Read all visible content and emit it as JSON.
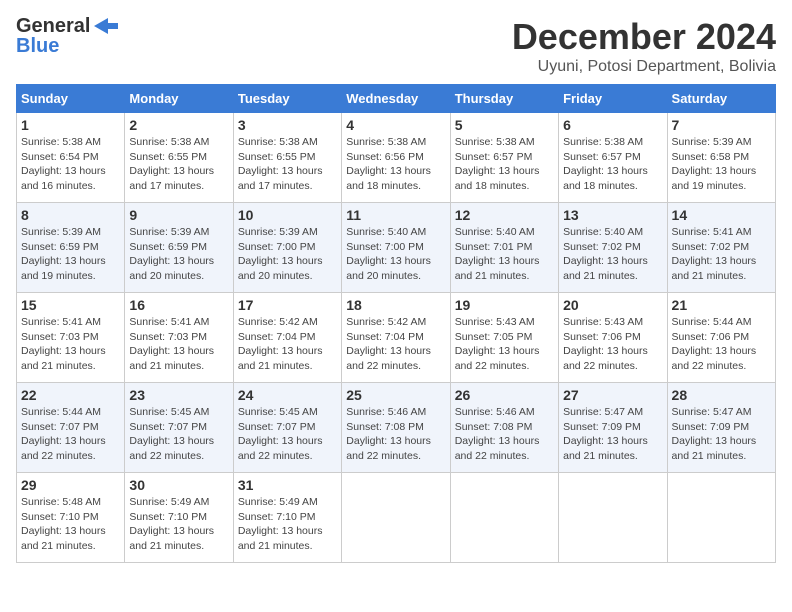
{
  "logo": {
    "general": "General",
    "blue": "Blue"
  },
  "title": "December 2024",
  "location": "Uyuni, Potosi Department, Bolivia",
  "days_of_week": [
    "Sunday",
    "Monday",
    "Tuesday",
    "Wednesday",
    "Thursday",
    "Friday",
    "Saturday"
  ],
  "weeks": [
    [
      {
        "day": 1,
        "info": "Sunrise: 5:38 AM\nSunset: 6:54 PM\nDaylight: 13 hours\nand 16 minutes."
      },
      {
        "day": 2,
        "info": "Sunrise: 5:38 AM\nSunset: 6:55 PM\nDaylight: 13 hours\nand 17 minutes."
      },
      {
        "day": 3,
        "info": "Sunrise: 5:38 AM\nSunset: 6:55 PM\nDaylight: 13 hours\nand 17 minutes."
      },
      {
        "day": 4,
        "info": "Sunrise: 5:38 AM\nSunset: 6:56 PM\nDaylight: 13 hours\nand 18 minutes."
      },
      {
        "day": 5,
        "info": "Sunrise: 5:38 AM\nSunset: 6:57 PM\nDaylight: 13 hours\nand 18 minutes."
      },
      {
        "day": 6,
        "info": "Sunrise: 5:38 AM\nSunset: 6:57 PM\nDaylight: 13 hours\nand 18 minutes."
      },
      {
        "day": 7,
        "info": "Sunrise: 5:39 AM\nSunset: 6:58 PM\nDaylight: 13 hours\nand 19 minutes."
      }
    ],
    [
      {
        "day": 8,
        "info": "Sunrise: 5:39 AM\nSunset: 6:59 PM\nDaylight: 13 hours\nand 19 minutes."
      },
      {
        "day": 9,
        "info": "Sunrise: 5:39 AM\nSunset: 6:59 PM\nDaylight: 13 hours\nand 20 minutes."
      },
      {
        "day": 10,
        "info": "Sunrise: 5:39 AM\nSunset: 7:00 PM\nDaylight: 13 hours\nand 20 minutes."
      },
      {
        "day": 11,
        "info": "Sunrise: 5:40 AM\nSunset: 7:00 PM\nDaylight: 13 hours\nand 20 minutes."
      },
      {
        "day": 12,
        "info": "Sunrise: 5:40 AM\nSunset: 7:01 PM\nDaylight: 13 hours\nand 21 minutes."
      },
      {
        "day": 13,
        "info": "Sunrise: 5:40 AM\nSunset: 7:02 PM\nDaylight: 13 hours\nand 21 minutes."
      },
      {
        "day": 14,
        "info": "Sunrise: 5:41 AM\nSunset: 7:02 PM\nDaylight: 13 hours\nand 21 minutes."
      }
    ],
    [
      {
        "day": 15,
        "info": "Sunrise: 5:41 AM\nSunset: 7:03 PM\nDaylight: 13 hours\nand 21 minutes."
      },
      {
        "day": 16,
        "info": "Sunrise: 5:41 AM\nSunset: 7:03 PM\nDaylight: 13 hours\nand 21 minutes."
      },
      {
        "day": 17,
        "info": "Sunrise: 5:42 AM\nSunset: 7:04 PM\nDaylight: 13 hours\nand 21 minutes."
      },
      {
        "day": 18,
        "info": "Sunrise: 5:42 AM\nSunset: 7:04 PM\nDaylight: 13 hours\nand 22 minutes."
      },
      {
        "day": 19,
        "info": "Sunrise: 5:43 AM\nSunset: 7:05 PM\nDaylight: 13 hours\nand 22 minutes."
      },
      {
        "day": 20,
        "info": "Sunrise: 5:43 AM\nSunset: 7:06 PM\nDaylight: 13 hours\nand 22 minutes."
      },
      {
        "day": 21,
        "info": "Sunrise: 5:44 AM\nSunset: 7:06 PM\nDaylight: 13 hours\nand 22 minutes."
      }
    ],
    [
      {
        "day": 22,
        "info": "Sunrise: 5:44 AM\nSunset: 7:07 PM\nDaylight: 13 hours\nand 22 minutes."
      },
      {
        "day": 23,
        "info": "Sunrise: 5:45 AM\nSunset: 7:07 PM\nDaylight: 13 hours\nand 22 minutes."
      },
      {
        "day": 24,
        "info": "Sunrise: 5:45 AM\nSunset: 7:07 PM\nDaylight: 13 hours\nand 22 minutes."
      },
      {
        "day": 25,
        "info": "Sunrise: 5:46 AM\nSunset: 7:08 PM\nDaylight: 13 hours\nand 22 minutes."
      },
      {
        "day": 26,
        "info": "Sunrise: 5:46 AM\nSunset: 7:08 PM\nDaylight: 13 hours\nand 22 minutes."
      },
      {
        "day": 27,
        "info": "Sunrise: 5:47 AM\nSunset: 7:09 PM\nDaylight: 13 hours\nand 21 minutes."
      },
      {
        "day": 28,
        "info": "Sunrise: 5:47 AM\nSunset: 7:09 PM\nDaylight: 13 hours\nand 21 minutes."
      }
    ],
    [
      {
        "day": 29,
        "info": "Sunrise: 5:48 AM\nSunset: 7:10 PM\nDaylight: 13 hours\nand 21 minutes."
      },
      {
        "day": 30,
        "info": "Sunrise: 5:49 AM\nSunset: 7:10 PM\nDaylight: 13 hours\nand 21 minutes."
      },
      {
        "day": 31,
        "info": "Sunrise: 5:49 AM\nSunset: 7:10 PM\nDaylight: 13 hours\nand 21 minutes."
      },
      null,
      null,
      null,
      null
    ]
  ]
}
